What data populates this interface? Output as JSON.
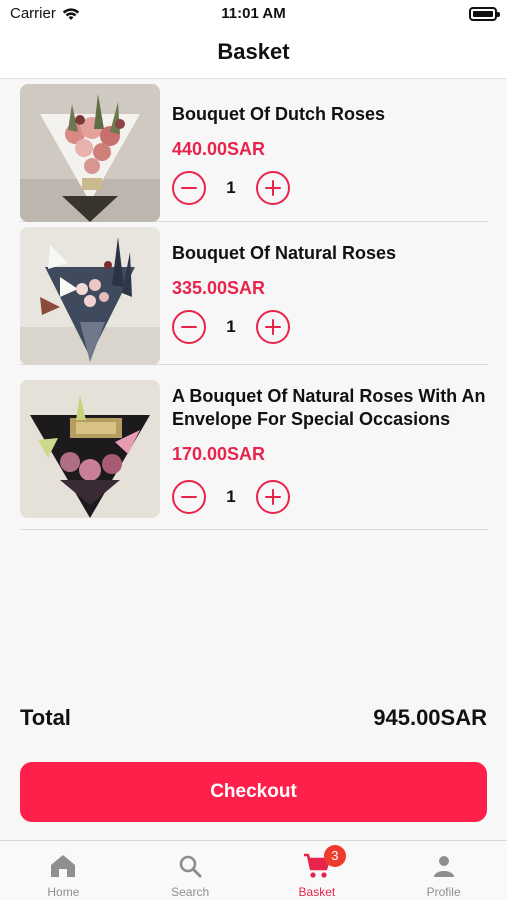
{
  "status_bar": {
    "carrier": "Carrier",
    "time": "11:01 AM"
  },
  "header": {
    "title": "Basket"
  },
  "items": [
    {
      "title": "Bouquet Of Dutch Roses",
      "price": "440.00SAR",
      "quantity": "1"
    },
    {
      "title": "Bouquet Of Natural Roses",
      "price": "335.00SAR",
      "quantity": "1"
    },
    {
      "title": "A Bouquet Of Natural Roses With An Envelope For Special Occasions",
      "price": "170.00SAR",
      "quantity": "1"
    }
  ],
  "summary": {
    "total_label": "Total",
    "total_value": "945.00SAR"
  },
  "checkout_label": "Checkout",
  "tabs": [
    {
      "label": "Home",
      "icon": "home-icon"
    },
    {
      "label": "Search",
      "icon": "search-icon"
    },
    {
      "label": "Basket",
      "icon": "cart-icon",
      "badge": "3",
      "active": true
    },
    {
      "label": "Profile",
      "icon": "person-icon"
    }
  ],
  "colors": {
    "accent": "#e8244d",
    "button": "#ff1f4b",
    "badge": "#ee3b2c"
  }
}
